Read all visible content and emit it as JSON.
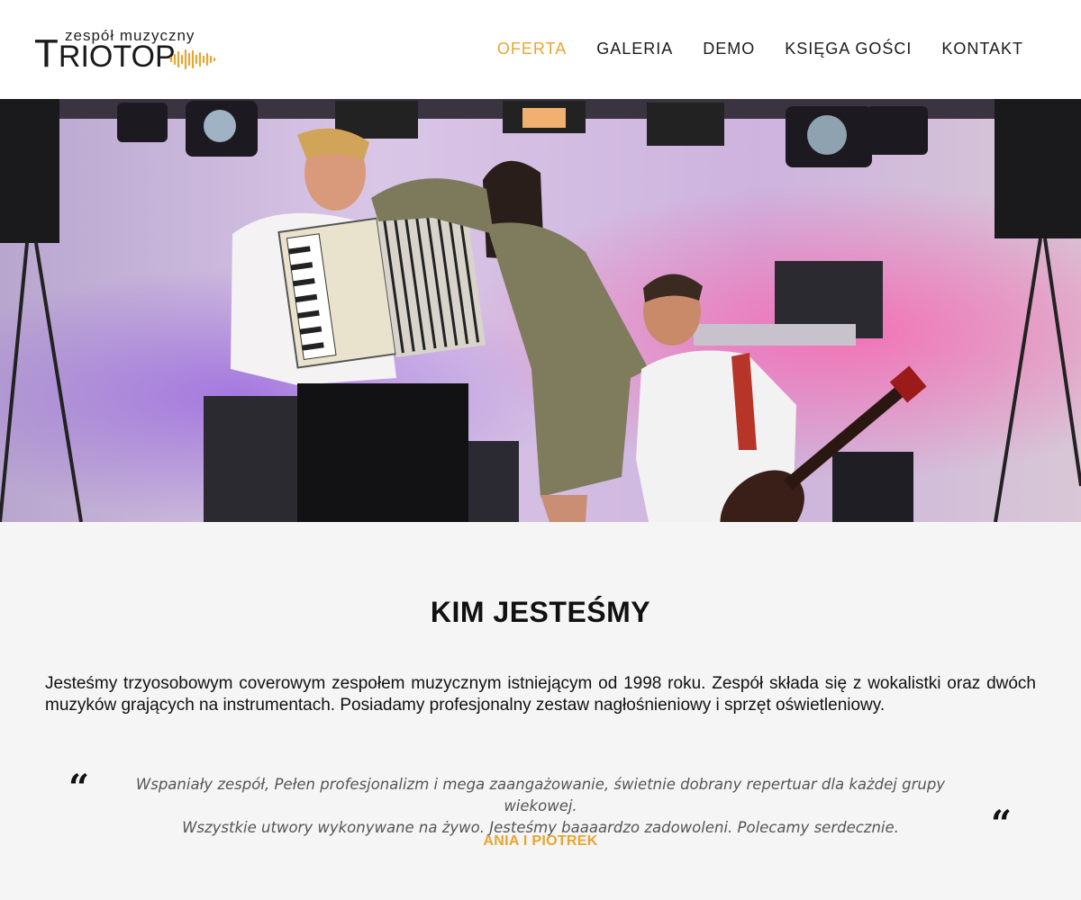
{
  "brand": {
    "subtitle": "zespół muzyczny",
    "name_first_letter": "T",
    "name_rest": "RIOTOP",
    "accent": "#e8a530"
  },
  "nav": {
    "items": [
      {
        "label": "OFERTA",
        "active": true
      },
      {
        "label": "GALERIA",
        "active": false
      },
      {
        "label": "DEMO",
        "active": false
      },
      {
        "label": "KSIĘGA GOŚCI",
        "active": false
      },
      {
        "label": "KONTAKT",
        "active": false
      }
    ]
  },
  "hero": {
    "image": "band-photo-on-stage"
  },
  "about": {
    "title": "KIM JESTEŚMY",
    "text": "Jesteśmy trzyosobowym coverowym zespołem muzycznym istniejącym od 1998 roku. Zespół składa się z wokalistki oraz dwóch muzyków grających na instrumentach. Posiadamy profesjonalny zestaw nagłośnieniowy i sprzęt oświetleniowy."
  },
  "testimonial": {
    "quote_open": "“",
    "quote_close": "“",
    "line1": "Wspaniały zespół, Pełen profesjonalizm i mega zaangażowanie, świetnie dobrany repertuar dla każdej grupy wiekowej.",
    "line2": "Wszystkie utwory wykonywane na żywo. Jesteśmy baaaardzo zadowoleni. Polecamy serdecznie.",
    "author": "ANIA I PIOTREK"
  }
}
